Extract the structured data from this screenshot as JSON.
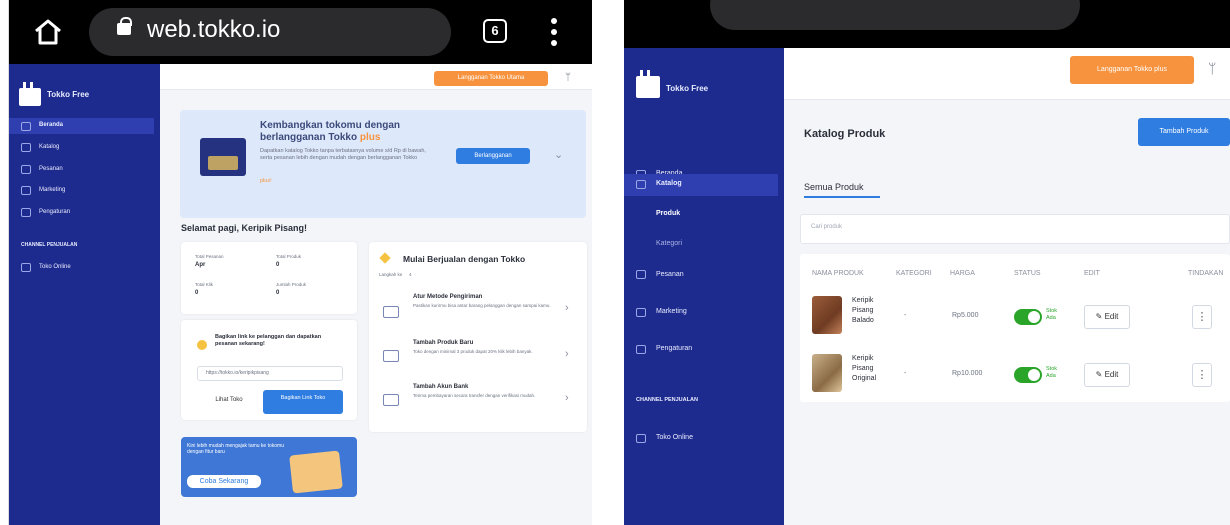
{
  "left": {
    "browser": {
      "url": "web.tokko.io",
      "tab_count": "6"
    },
    "sidebar": {
      "brand": "Tokko Free",
      "items": [
        {
          "label": "Beranda",
          "icon": "home-icon"
        },
        {
          "label": "Katalog",
          "icon": "catalog-icon"
        },
        {
          "label": "Pesanan",
          "icon": "orders-icon"
        },
        {
          "label": "Marketing",
          "icon": "marketing-icon"
        },
        {
          "label": "Pengaturan",
          "icon": "settings-icon"
        }
      ],
      "section_label": "CHANNEL PENJUALAN",
      "channel_item": "Toko Online"
    },
    "topbar": {
      "subscribe_button": "Langganan Tokko Utama"
    },
    "promo": {
      "title": "Kembangkan tokomu dengan berlangganan Tokko",
      "plus": "plus",
      "body": "Dapatkan katalog Tokko tanpa terbatasnya volume s/d Rp di bawah, serta pesanan lebih dengan mudah dengan berlangganan Tokko",
      "link": "plus!",
      "button": "Berlangganan"
    },
    "greeting": "Selamat pagi, Keripik Pisang!",
    "stats": [
      {
        "label": "Total Pesanan",
        "value": "Apr"
      },
      {
        "label": "Total Produk",
        "value": "0"
      },
      {
        "label": "Total Klik",
        "value": "0"
      },
      {
        "label": "Jumlah Produk",
        "value": "0"
      }
    ],
    "share": {
      "text": "Bagikan link ke pelanggan dan dapatkan pesanan sekarang!",
      "link": "https://tokko.io/keripikpisang",
      "view_button": "Lihat Toko",
      "share_button": "Bagikan Link Toko"
    },
    "start": {
      "title": "Mulai Berjualan dengan Tokko",
      "progress_label": "Langkah ke",
      "progress_value": "4",
      "steps": [
        {
          "title": "Atur Metode Pengiriman",
          "desc": "Pastikan kurirmu bisa antar barang pelanggan dengan sampai kamu."
        },
        {
          "title": "Tambah Produk Baru",
          "desc": "Toko dengan minimal 3 produk dapat 20% klik lebih banyak."
        },
        {
          "title": "Tambah Akun Bank",
          "desc": "Terima pembayaran secara transfer dengan verifikasi mudah."
        }
      ]
    },
    "banner": {
      "text": "Kini lebih mudah mengajak tamu ke tokomu dengan fitur baru",
      "button": "Coba Sekarang"
    }
  },
  "right": {
    "sidebar": {
      "brand": "Tokko Free",
      "items": [
        {
          "label": "Beranda",
          "icon": "home-icon"
        },
        {
          "label": "Katalog",
          "icon": "catalog-icon"
        },
        {
          "label": "Produk"
        },
        {
          "label": "Kategori"
        },
        {
          "label": "Pesanan",
          "icon": "orders-icon"
        },
        {
          "label": "Marketing",
          "icon": "marketing-icon"
        },
        {
          "label": "Pengaturan",
          "icon": "settings-icon"
        }
      ],
      "section_label": "CHANNEL PENJUALAN",
      "channel_item": "Toko Online"
    },
    "topbar": {
      "subscribe_button": "Langganan Tokko plus",
      "icon": "user-icon"
    },
    "page_title": "Katalog Produk",
    "add_button": "Tambah Produk",
    "tab": "Semua Produk",
    "search_placeholder": "Cari produk",
    "table": {
      "headers": [
        "NAMA PRODUK",
        "KATEGORI",
        "HARGA",
        "STATUS",
        "EDIT",
        "TINDAKAN"
      ],
      "rows": [
        {
          "name": "Keripik Pisang Balado",
          "category": "-",
          "price": "Rp5.000",
          "status": "Stok Ada",
          "edit": "Edit"
        },
        {
          "name": "Keripik Pisang Original",
          "category": "-",
          "price": "Rp10.000",
          "status": "Stok Ada",
          "edit": "Edit"
        }
      ]
    }
  }
}
